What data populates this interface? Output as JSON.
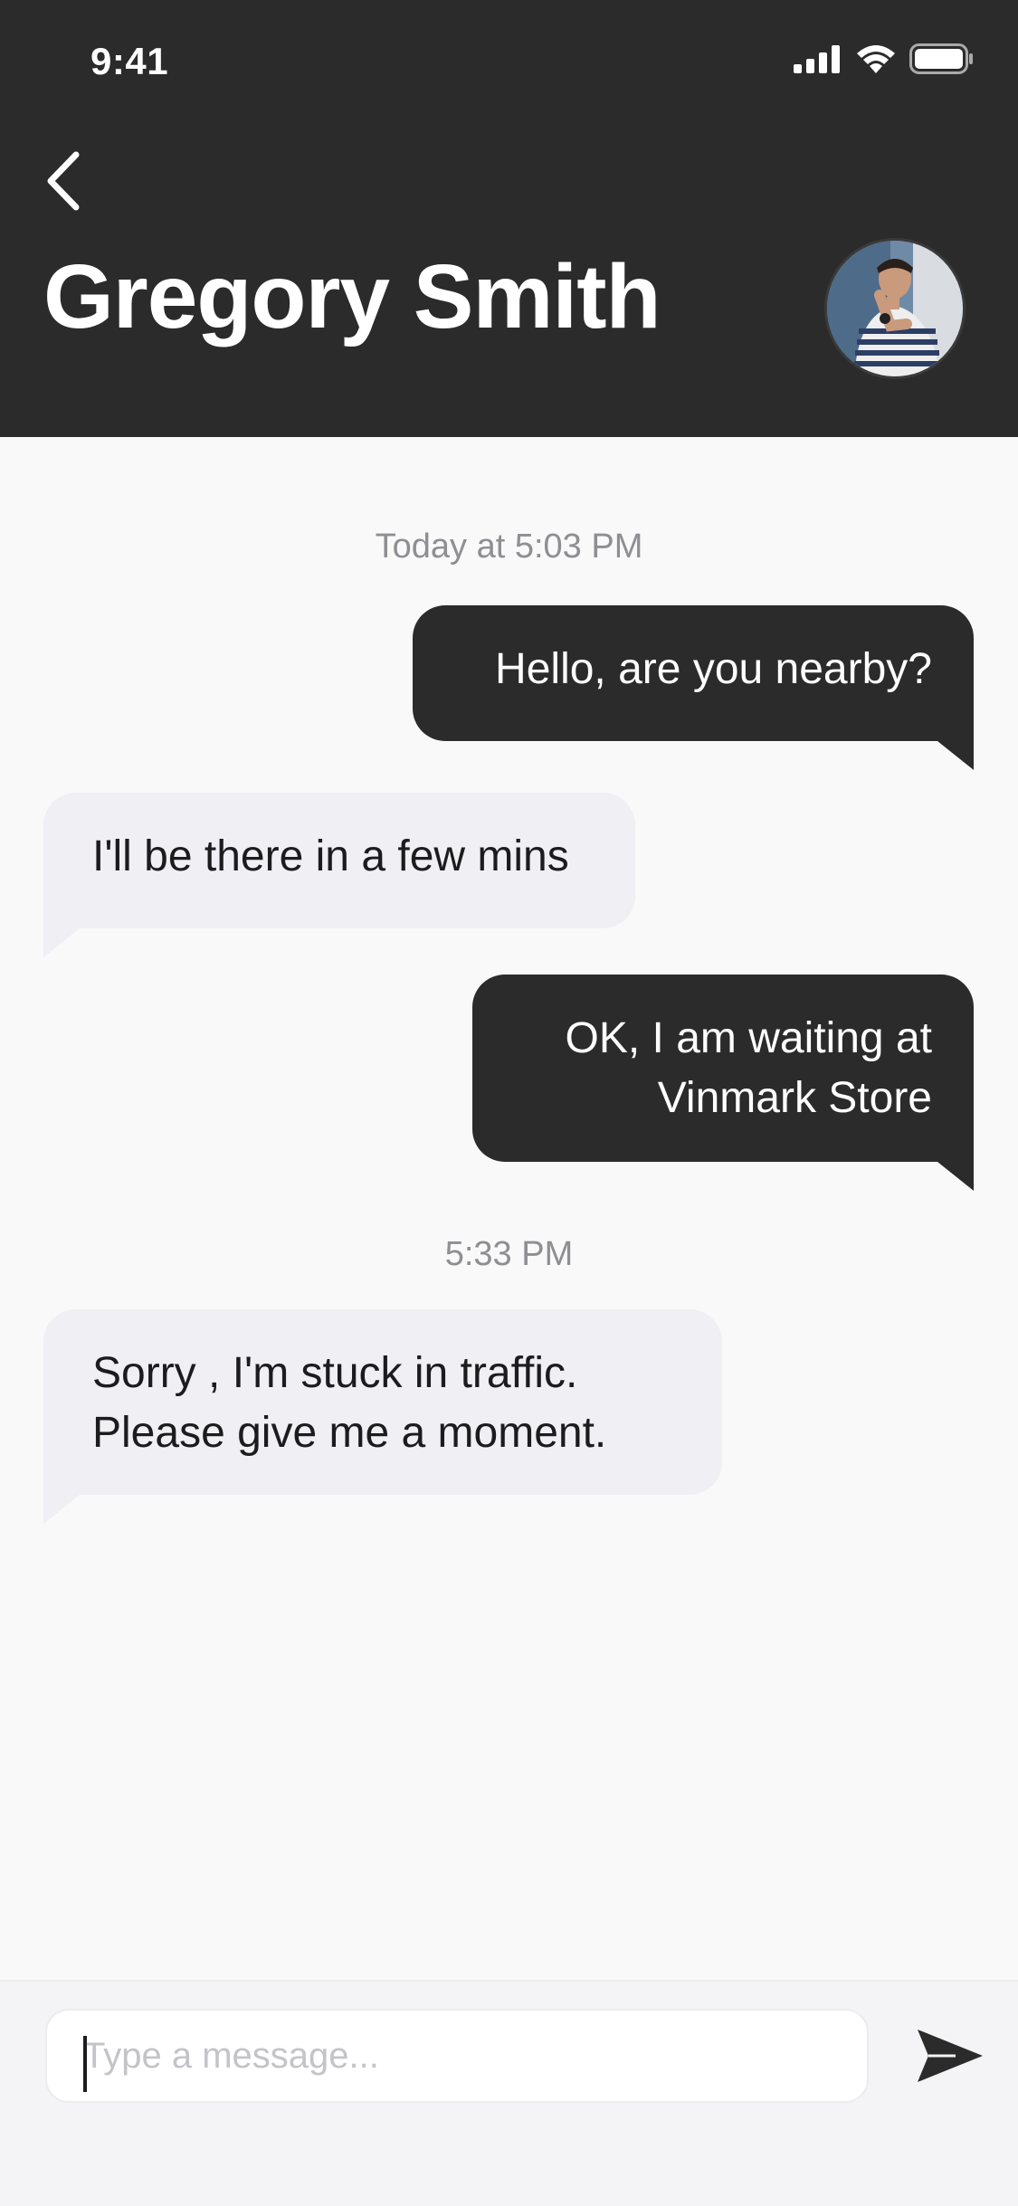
{
  "status_bar": {
    "time": "9:41"
  },
  "header": {
    "contact_name": "Gregory Smith",
    "back_icon": "chevron-left-icon",
    "avatar_icon": "avatar"
  },
  "chat": {
    "timestamps": [
      "Today at 5:03 PM",
      "5:33 PM"
    ],
    "messages": [
      {
        "direction": "outgoing",
        "text": "Hello, are you nearby?"
      },
      {
        "direction": "incoming",
        "text": "I'll be there in a few mins"
      },
      {
        "direction": "outgoing",
        "line1": "OK, I am waiting at",
        "line2": "Vinmark Store"
      },
      {
        "direction": "incoming",
        "line1": "Sorry , I'm stuck in traffic.",
        "line2": "Please give me a moment."
      }
    ]
  },
  "composer": {
    "placeholder": "Type a message...",
    "value": "",
    "send_icon": "send-icon"
  },
  "colors": {
    "header_bg": "#2b2b2b",
    "outgoing_bubble": "#2b2b2b",
    "incoming_bubble": "#efeff4",
    "background": "#f9f9f9",
    "timestamp_text": "#8e8e93"
  }
}
